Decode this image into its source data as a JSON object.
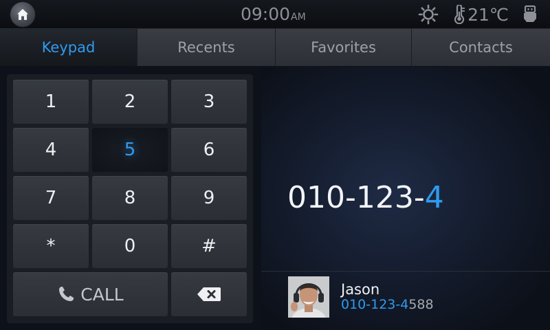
{
  "status": {
    "time": "09:00",
    "ampm": "AM",
    "temperature": "21℃",
    "icons": [
      "home-icon",
      "brightness-icon",
      "thermometer-icon",
      "usb-icon"
    ]
  },
  "tabs": [
    {
      "label": "Keypad",
      "active": true
    },
    {
      "label": "Recents",
      "active": false
    },
    {
      "label": "Favorites",
      "active": false
    },
    {
      "label": "Contacts",
      "active": false
    }
  ],
  "keypad": {
    "keys": [
      "1",
      "2",
      "3",
      "4",
      "5",
      "6",
      "7",
      "8",
      "9",
      "*",
      "0",
      "#"
    ],
    "pressed_key": "5",
    "call_label": "CALL",
    "call_icon": "phone-icon",
    "backspace_icon": "backspace-icon"
  },
  "dialed": {
    "prefix": "010-123-",
    "last": "4"
  },
  "suggestion": {
    "name": "Jason",
    "number_match": "010-123-4",
    "number_rest": "588",
    "avatar": "contact-photo"
  },
  "colors": {
    "accent": "#2f9bf0",
    "background": "#0d1119",
    "key": "#31353b"
  }
}
